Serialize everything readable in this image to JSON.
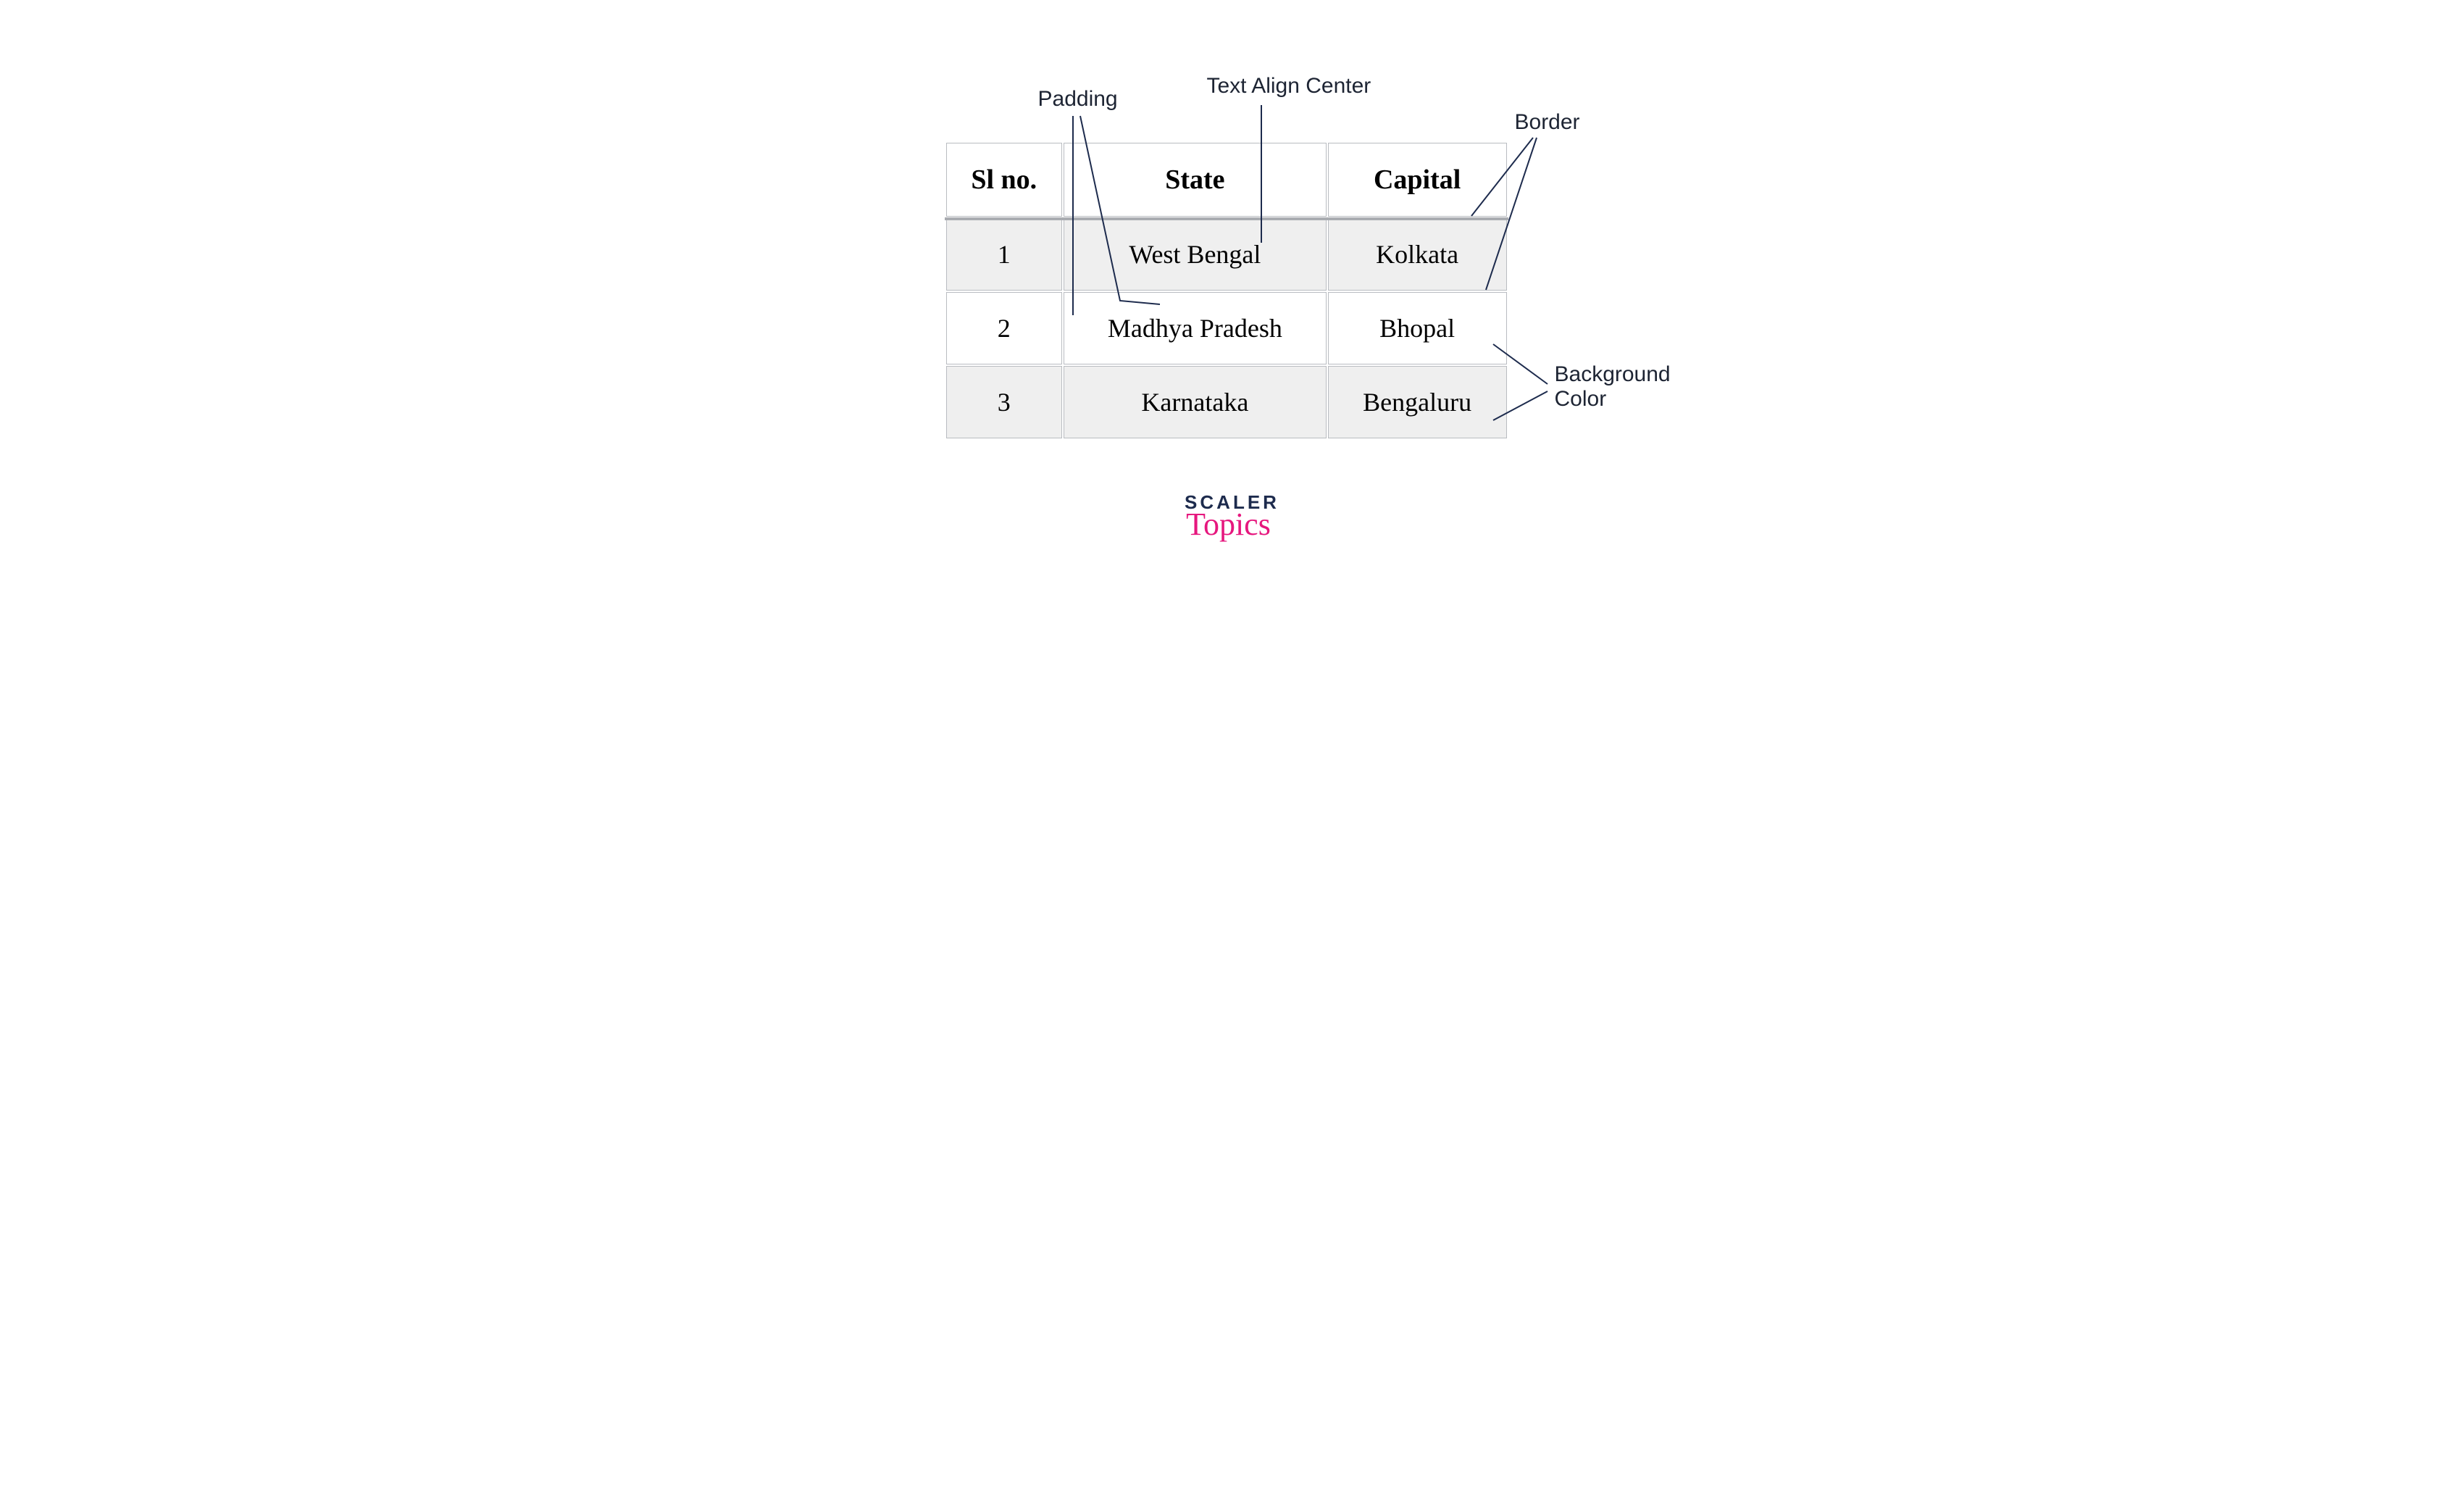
{
  "annotations": {
    "padding": "Padding",
    "text_align": "Text Align Center",
    "border": "Border",
    "bg_color_line1": "Background",
    "bg_color_line2": "Color"
  },
  "table": {
    "headers": {
      "slno": "Sl no.",
      "state": "State",
      "capital": "Capital"
    },
    "rows": [
      {
        "slno": "1",
        "state": "West Bengal",
        "capital": "Kolkata"
      },
      {
        "slno": "2",
        "state": "Madhya Pradesh",
        "capital": "Bhopal"
      },
      {
        "slno": "3",
        "state": "Karnataka",
        "capital": "Bengaluru"
      }
    ]
  },
  "logo": {
    "line1": "SCALER",
    "line2": "Topics"
  },
  "colors": {
    "cell_border": "#b9bcc1",
    "row_stripe": "#efefef",
    "ink": "#1d2b4d",
    "pink": "#e6177e"
  }
}
